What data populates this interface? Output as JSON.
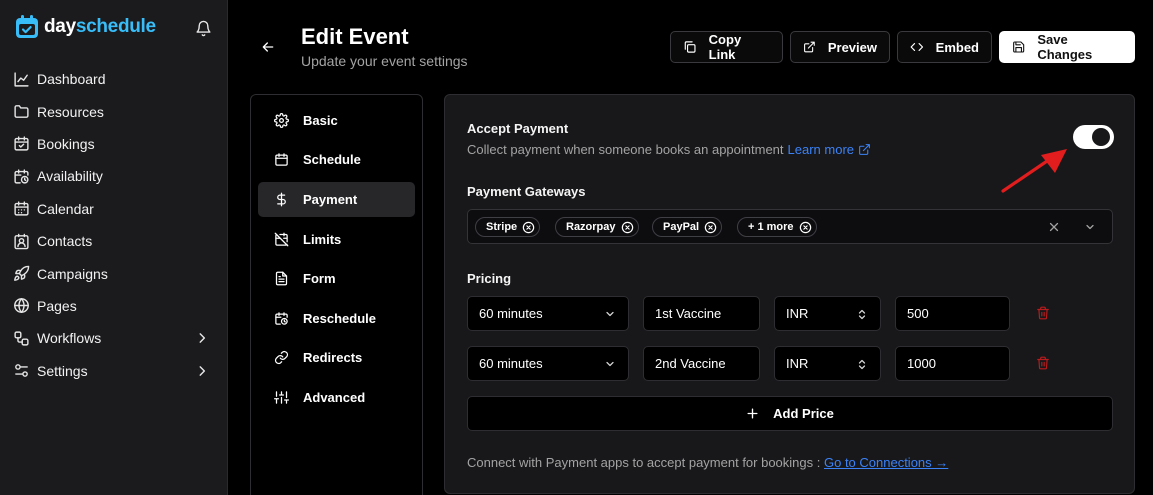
{
  "app": {
    "logo_plain": "day",
    "logo_accent": "schedule"
  },
  "sidebar": {
    "items": [
      {
        "label": "Dashboard",
        "icon": "chart-line-icon"
      },
      {
        "label": "Resources",
        "icon": "folder-icon"
      },
      {
        "label": "Bookings",
        "icon": "calendar-check-icon"
      },
      {
        "label": "Availability",
        "icon": "calendar-clock-icon"
      },
      {
        "label": "Calendar",
        "icon": "calendar-icon"
      },
      {
        "label": "Contacts",
        "icon": "contact-icon"
      },
      {
        "label": "Campaigns",
        "icon": "rocket-icon"
      },
      {
        "label": "Pages",
        "icon": "globe-icon"
      },
      {
        "label": "Workflows",
        "icon": "workflow-icon"
      },
      {
        "label": "Settings",
        "icon": "sliders-icon"
      }
    ]
  },
  "header": {
    "title": "Edit Event",
    "subtitle": "Update your event settings",
    "copy_link": "Copy Link",
    "preview": "Preview",
    "embed": "Embed",
    "save": "Save Changes"
  },
  "settings_menu": {
    "items": [
      "Basic",
      "Schedule",
      "Payment",
      "Limits",
      "Form",
      "Reschedule",
      "Redirects",
      "Advanced"
    ],
    "active": "Payment"
  },
  "payment": {
    "accept_label": "Accept Payment",
    "accept_desc": "Collect payment when someone books an appointment",
    "learn_more": "Learn more",
    "accept_enabled": true,
    "gateways_label": "Payment Gateways",
    "gateways": [
      "Stripe",
      "Razorpay",
      "PayPal",
      "+ 1 more"
    ],
    "pricing_label": "Pricing",
    "pricing": [
      {
        "duration": "60 minutes",
        "name": "1st Vaccine",
        "currency": "INR",
        "amount": "500"
      },
      {
        "duration": "60 minutes",
        "name": "2nd Vaccine",
        "currency": "INR",
        "amount": "1000"
      }
    ],
    "add_price": "Add Price",
    "connect_text": "Connect with Payment apps to accept payment for bookings : ",
    "connect_link": "Go to Connections →"
  },
  "colors": {
    "accent_blue": "#3b82f6",
    "logo_blue": "#38bdf8",
    "danger_red": "#b91c1c",
    "arrow_red": "#e11d1d"
  }
}
